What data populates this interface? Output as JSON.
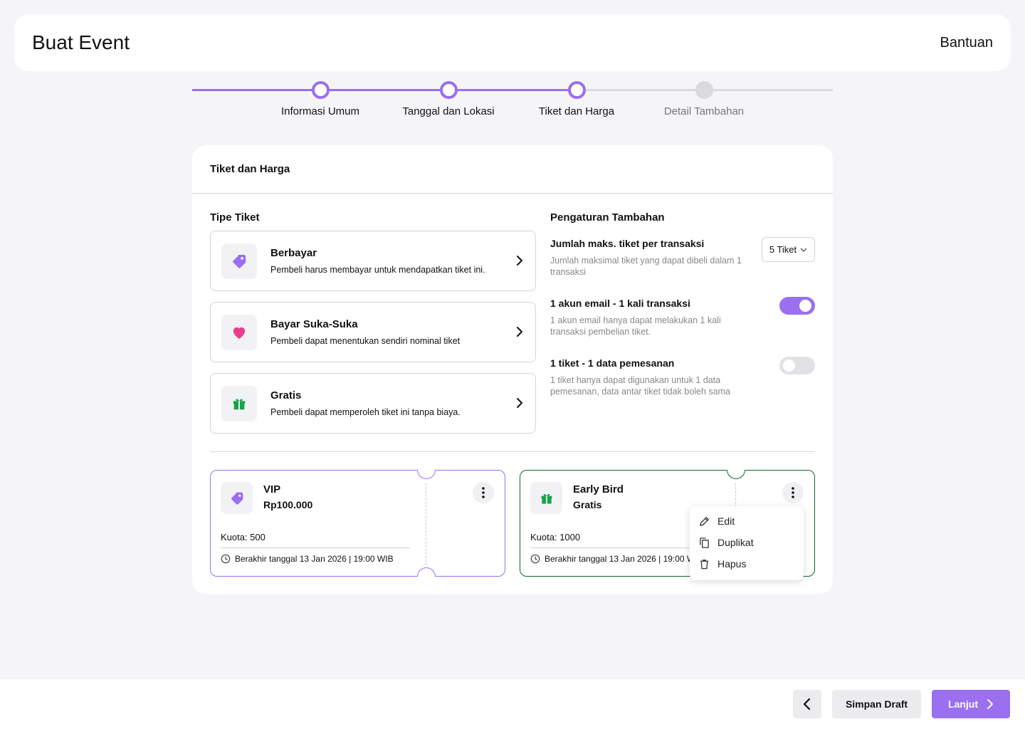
{
  "header": {
    "title": "Buat Event",
    "help_label": "Bantuan"
  },
  "stepper": {
    "steps": [
      {
        "label": "Informasi Umum",
        "state": "done"
      },
      {
        "label": "Tanggal dan Lokasi",
        "state": "done"
      },
      {
        "label": "Tiket dan Harga",
        "state": "current"
      },
      {
        "label": "Detail Tambahan",
        "state": "todo"
      }
    ]
  },
  "card": {
    "title": "Tiket dan Harga",
    "ticket_type": {
      "heading": "Tipe Tiket",
      "options": [
        {
          "title": "Berbayar",
          "desc": "Pembeli harus membayar untuk mendapatkan tiket ini.",
          "icon": "price-tag-icon"
        },
        {
          "title": "Bayar Suka-Suka",
          "desc": "Pembeli dapat menentukan sendiri nominal tiket",
          "icon": "heart-icon"
        },
        {
          "title": "Gratis",
          "desc": "Pembeli dapat memperoleh tiket ini tanpa biaya.",
          "icon": "gift-icon"
        }
      ]
    },
    "settings": {
      "heading": "Pengaturan Tambahan",
      "max_tickets": {
        "label": "Jumlah maks. tiket per transaksi",
        "desc": "Jumlah maksimal tiket yang dapat dibeli dalam 1 transaksi",
        "value": "5 Tiket"
      },
      "email_limit": {
        "label": "1 akun email - 1 kali transaksi",
        "desc": "1 akun email hanya dapat melakukan 1 kali transaksi pembelian tiket.",
        "enabled": true
      },
      "ticket_data": {
        "label": "1 tiket - 1 data pemesanan",
        "desc": "1 tiket hanya dapat digunakan untuk 1 data pemesanan, data antar tiket tidak boleh sama",
        "enabled": false
      }
    },
    "tickets": [
      {
        "name": "VIP",
        "price": "Rp100.000",
        "quota": "Kuota: 500",
        "end": "Berakhir tanggal 13 Jan 2026 | 19:00 WIB",
        "accent": "#9a6ff0"
      },
      {
        "name": "Early Bird",
        "price": "Gratis",
        "quota": "Kuota: 1000",
        "end": "Berakhir tanggal 13 Jan 2026 | 19:00 WIB",
        "accent": "#0a6b2a"
      }
    ],
    "context_menu": {
      "items": [
        "Edit",
        "Duplikat",
        "Hapus"
      ]
    }
  },
  "footer": {
    "draft_label": "Simpan Draft",
    "next_label": "Lanjut"
  },
  "colors": {
    "accent": "#9a6ff0",
    "green": "#16a34a",
    "pink": "#e83e8c"
  }
}
